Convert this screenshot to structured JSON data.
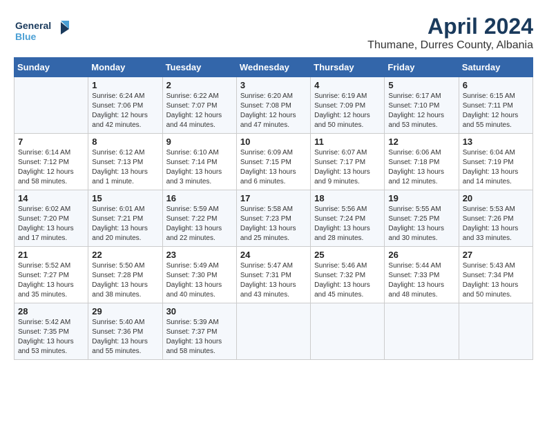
{
  "header": {
    "logo_general": "General",
    "logo_blue": "Blue",
    "title": "April 2024",
    "subtitle": "Thumane, Durres County, Albania"
  },
  "weekdays": [
    "Sunday",
    "Monday",
    "Tuesday",
    "Wednesday",
    "Thursday",
    "Friday",
    "Saturday"
  ],
  "weeks": [
    [
      {
        "day": "",
        "sunrise": "",
        "sunset": "",
        "daylight": ""
      },
      {
        "day": "1",
        "sunrise": "Sunrise: 6:24 AM",
        "sunset": "Sunset: 7:06 PM",
        "daylight": "Daylight: 12 hours and 42 minutes."
      },
      {
        "day": "2",
        "sunrise": "Sunrise: 6:22 AM",
        "sunset": "Sunset: 7:07 PM",
        "daylight": "Daylight: 12 hours and 44 minutes."
      },
      {
        "day": "3",
        "sunrise": "Sunrise: 6:20 AM",
        "sunset": "Sunset: 7:08 PM",
        "daylight": "Daylight: 12 hours and 47 minutes."
      },
      {
        "day": "4",
        "sunrise": "Sunrise: 6:19 AM",
        "sunset": "Sunset: 7:09 PM",
        "daylight": "Daylight: 12 hours and 50 minutes."
      },
      {
        "day": "5",
        "sunrise": "Sunrise: 6:17 AM",
        "sunset": "Sunset: 7:10 PM",
        "daylight": "Daylight: 12 hours and 53 minutes."
      },
      {
        "day": "6",
        "sunrise": "Sunrise: 6:15 AM",
        "sunset": "Sunset: 7:11 PM",
        "daylight": "Daylight: 12 hours and 55 minutes."
      }
    ],
    [
      {
        "day": "7",
        "sunrise": "Sunrise: 6:14 AM",
        "sunset": "Sunset: 7:12 PM",
        "daylight": "Daylight: 12 hours and 58 minutes."
      },
      {
        "day": "8",
        "sunrise": "Sunrise: 6:12 AM",
        "sunset": "Sunset: 7:13 PM",
        "daylight": "Daylight: 13 hours and 1 minute."
      },
      {
        "day": "9",
        "sunrise": "Sunrise: 6:10 AM",
        "sunset": "Sunset: 7:14 PM",
        "daylight": "Daylight: 13 hours and 3 minutes."
      },
      {
        "day": "10",
        "sunrise": "Sunrise: 6:09 AM",
        "sunset": "Sunset: 7:15 PM",
        "daylight": "Daylight: 13 hours and 6 minutes."
      },
      {
        "day": "11",
        "sunrise": "Sunrise: 6:07 AM",
        "sunset": "Sunset: 7:17 PM",
        "daylight": "Daylight: 13 hours and 9 minutes."
      },
      {
        "day": "12",
        "sunrise": "Sunrise: 6:06 AM",
        "sunset": "Sunset: 7:18 PM",
        "daylight": "Daylight: 13 hours and 12 minutes."
      },
      {
        "day": "13",
        "sunrise": "Sunrise: 6:04 AM",
        "sunset": "Sunset: 7:19 PM",
        "daylight": "Daylight: 13 hours and 14 minutes."
      }
    ],
    [
      {
        "day": "14",
        "sunrise": "Sunrise: 6:02 AM",
        "sunset": "Sunset: 7:20 PM",
        "daylight": "Daylight: 13 hours and 17 minutes."
      },
      {
        "day": "15",
        "sunrise": "Sunrise: 6:01 AM",
        "sunset": "Sunset: 7:21 PM",
        "daylight": "Daylight: 13 hours and 20 minutes."
      },
      {
        "day": "16",
        "sunrise": "Sunrise: 5:59 AM",
        "sunset": "Sunset: 7:22 PM",
        "daylight": "Daylight: 13 hours and 22 minutes."
      },
      {
        "day": "17",
        "sunrise": "Sunrise: 5:58 AM",
        "sunset": "Sunset: 7:23 PM",
        "daylight": "Daylight: 13 hours and 25 minutes."
      },
      {
        "day": "18",
        "sunrise": "Sunrise: 5:56 AM",
        "sunset": "Sunset: 7:24 PM",
        "daylight": "Daylight: 13 hours and 28 minutes."
      },
      {
        "day": "19",
        "sunrise": "Sunrise: 5:55 AM",
        "sunset": "Sunset: 7:25 PM",
        "daylight": "Daylight: 13 hours and 30 minutes."
      },
      {
        "day": "20",
        "sunrise": "Sunrise: 5:53 AM",
        "sunset": "Sunset: 7:26 PM",
        "daylight": "Daylight: 13 hours and 33 minutes."
      }
    ],
    [
      {
        "day": "21",
        "sunrise": "Sunrise: 5:52 AM",
        "sunset": "Sunset: 7:27 PM",
        "daylight": "Daylight: 13 hours and 35 minutes."
      },
      {
        "day": "22",
        "sunrise": "Sunrise: 5:50 AM",
        "sunset": "Sunset: 7:28 PM",
        "daylight": "Daylight: 13 hours and 38 minutes."
      },
      {
        "day": "23",
        "sunrise": "Sunrise: 5:49 AM",
        "sunset": "Sunset: 7:30 PM",
        "daylight": "Daylight: 13 hours and 40 minutes."
      },
      {
        "day": "24",
        "sunrise": "Sunrise: 5:47 AM",
        "sunset": "Sunset: 7:31 PM",
        "daylight": "Daylight: 13 hours and 43 minutes."
      },
      {
        "day": "25",
        "sunrise": "Sunrise: 5:46 AM",
        "sunset": "Sunset: 7:32 PM",
        "daylight": "Daylight: 13 hours and 45 minutes."
      },
      {
        "day": "26",
        "sunrise": "Sunrise: 5:44 AM",
        "sunset": "Sunset: 7:33 PM",
        "daylight": "Daylight: 13 hours and 48 minutes."
      },
      {
        "day": "27",
        "sunrise": "Sunrise: 5:43 AM",
        "sunset": "Sunset: 7:34 PM",
        "daylight": "Daylight: 13 hours and 50 minutes."
      }
    ],
    [
      {
        "day": "28",
        "sunrise": "Sunrise: 5:42 AM",
        "sunset": "Sunset: 7:35 PM",
        "daylight": "Daylight: 13 hours and 53 minutes."
      },
      {
        "day": "29",
        "sunrise": "Sunrise: 5:40 AM",
        "sunset": "Sunset: 7:36 PM",
        "daylight": "Daylight: 13 hours and 55 minutes."
      },
      {
        "day": "30",
        "sunrise": "Sunrise: 5:39 AM",
        "sunset": "Sunset: 7:37 PM",
        "daylight": "Daylight: 13 hours and 58 minutes."
      },
      {
        "day": "",
        "sunrise": "",
        "sunset": "",
        "daylight": ""
      },
      {
        "day": "",
        "sunrise": "",
        "sunset": "",
        "daylight": ""
      },
      {
        "day": "",
        "sunrise": "",
        "sunset": "",
        "daylight": ""
      },
      {
        "day": "",
        "sunrise": "",
        "sunset": "",
        "daylight": ""
      }
    ]
  ]
}
